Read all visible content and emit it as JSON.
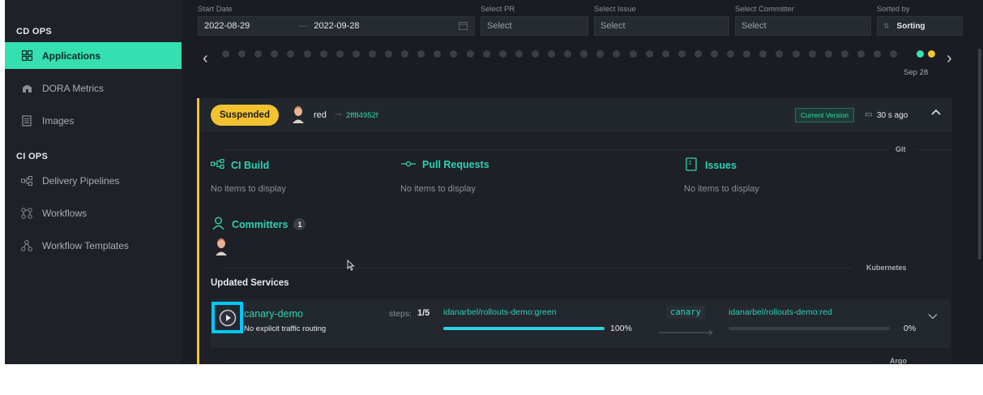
{
  "sidebar": {
    "cd_ops_title": "CD OPS",
    "ci_ops_title": "CI OPS",
    "items": [
      {
        "label": "Applications",
        "icon": "grid-icon"
      },
      {
        "label": "DORA Metrics",
        "icon": "gauge-icon"
      },
      {
        "label": "Images",
        "icon": "document-icon"
      },
      {
        "label": "Delivery Pipelines",
        "icon": "pipeline-icon"
      },
      {
        "label": "Workflows",
        "icon": "workflow-icon"
      },
      {
        "label": "Workflow Templates",
        "icon": "template-icon"
      }
    ]
  },
  "filters": {
    "start_date_label": "Start Date",
    "start_date_from": "2022-08-29",
    "start_date_sep": "—",
    "start_date_to": "2022-09-28",
    "pr_label": "Select PR",
    "pr_placeholder": "Select",
    "issue_label": "Select Issue",
    "issue_placeholder": "Select",
    "committer_label": "Select Committer",
    "committer_placeholder": "Select",
    "sorted_label": "Sorted by",
    "sorted_value": "Sorting"
  },
  "timeline": {
    "date_label": "Sep 28",
    "active_colors": [
      "#35e0b0",
      "#f2c230"
    ]
  },
  "release": {
    "status": "Suspended",
    "author": "red",
    "commit": "2ff84952f",
    "current_version": "Current Version",
    "time_ago": "30 s ago",
    "git_label": "Git",
    "kubernetes_label": "Kubernetes",
    "argo_label": "Argo",
    "ci_build_title": "CI Build",
    "ci_build_empty": "No items to display",
    "pull_requests_title": "Pull Requests",
    "pull_requests_empty": "No items to display",
    "issues_title": "Issues",
    "issues_empty": "No items to display",
    "committers_title": "Committers",
    "committers_count": "1",
    "updated_services_title": "Updated Services"
  },
  "service": {
    "name": "canary-demo",
    "routing": "No explicit traffic routing",
    "steps_label": "steps:",
    "steps_value": "1/5",
    "stable_image": "idanarbel/rollouts-demo:green",
    "stable_percent": "100%",
    "stable_progress": 1.0,
    "strategy": "canary",
    "canary_image": "idanarbel/rollouts-demo:red",
    "canary_percent": "0%",
    "canary_progress": 0.0
  },
  "colors": {
    "accent": "#35e0b0",
    "suspended": "#f2c230",
    "highlight": "#00c8ff"
  }
}
